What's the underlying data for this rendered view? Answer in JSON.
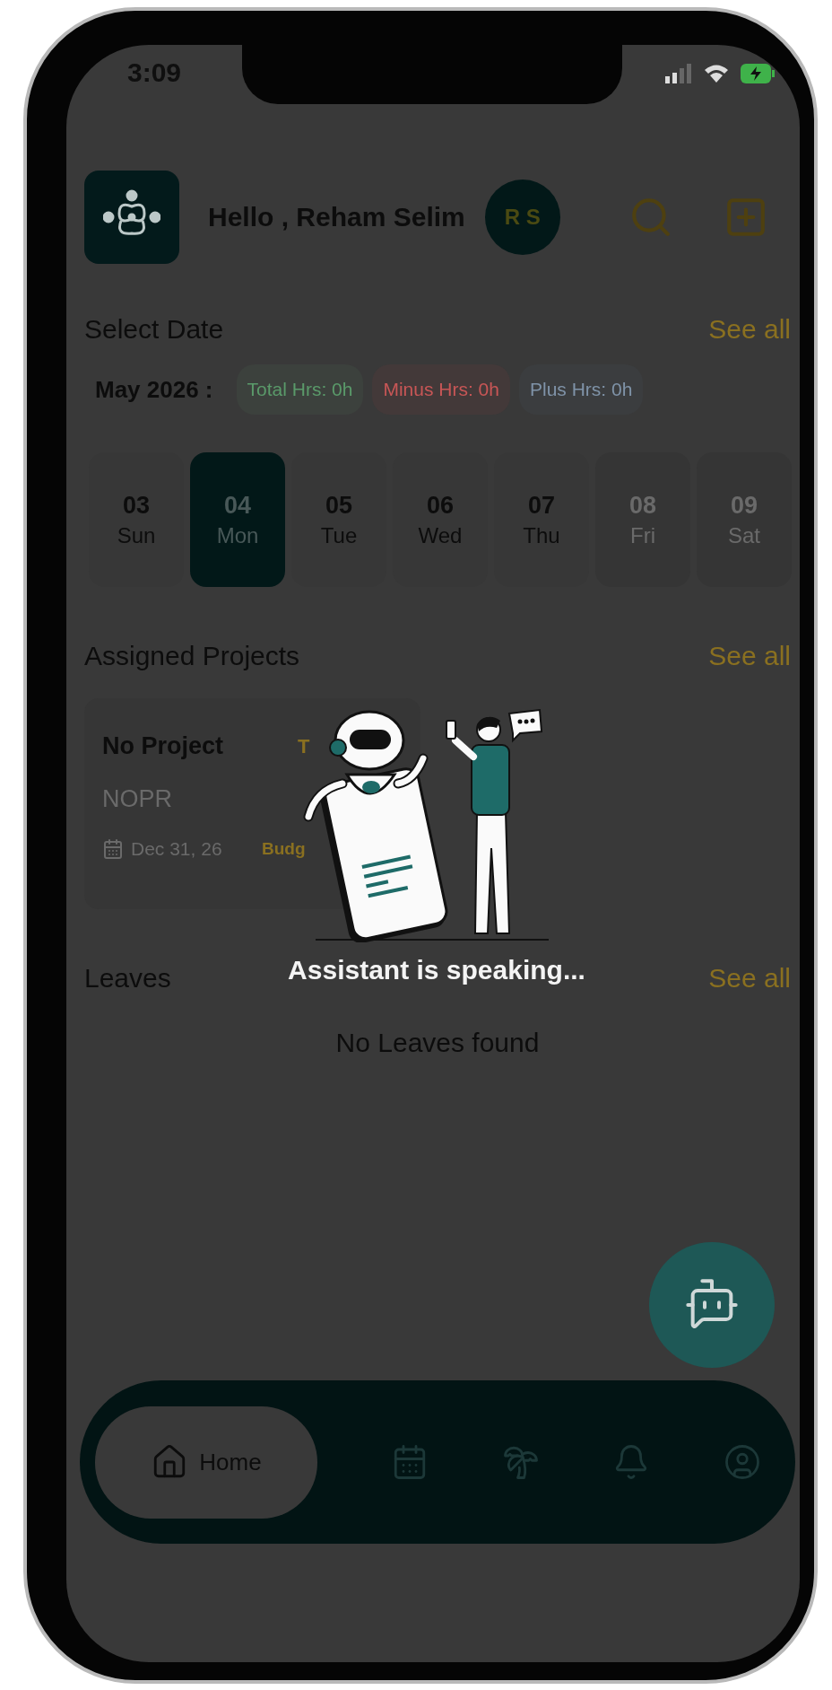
{
  "status_bar": {
    "time": "3:09"
  },
  "header": {
    "greeting": "Hello , Reham Selim",
    "avatar_initials": "R S"
  },
  "select_date": {
    "title": "Select Date",
    "see_all": "See all",
    "month": "May 2026 :",
    "chips": [
      {
        "label": "Total Hrs: 0h",
        "kind": "total"
      },
      {
        "label": "Minus Hrs: 0h",
        "kind": "minus"
      },
      {
        "label": "Plus Hrs: 0h",
        "kind": "plus"
      }
    ]
  },
  "days": [
    {
      "date": "03",
      "day": "Sun",
      "selected": false,
      "disabled": false
    },
    {
      "date": "04",
      "day": "Mon",
      "selected": true,
      "disabled": false
    },
    {
      "date": "05",
      "day": "Tue",
      "selected": false,
      "disabled": false
    },
    {
      "date": "06",
      "day": "Wed",
      "selected": false,
      "disabled": false
    },
    {
      "date": "07",
      "day": "Thu",
      "selected": false,
      "disabled": false
    },
    {
      "date": "08",
      "day": "Fri",
      "selected": false,
      "disabled": true
    },
    {
      "date": "09",
      "day": "Sat",
      "selected": false,
      "disabled": true
    }
  ],
  "projects": {
    "title": "Assigned Projects",
    "see_all": "See all",
    "cards": [
      {
        "name": "No Project",
        "code": "NOPR",
        "date": "Dec 31, 26",
        "tag": "T",
        "budget": "Budg"
      }
    ]
  },
  "assistant": {
    "status": "Assistant is speaking..."
  },
  "leaves": {
    "title": "Leaves",
    "see_all": "See all",
    "empty": "No Leaves found"
  },
  "nav": [
    {
      "kind": "home",
      "label": "Home",
      "selected": true
    },
    {
      "kind": "calendar",
      "selected": false
    },
    {
      "kind": "vacation",
      "selected": false
    },
    {
      "kind": "notifications",
      "selected": false
    },
    {
      "kind": "profile",
      "selected": false
    }
  ]
}
